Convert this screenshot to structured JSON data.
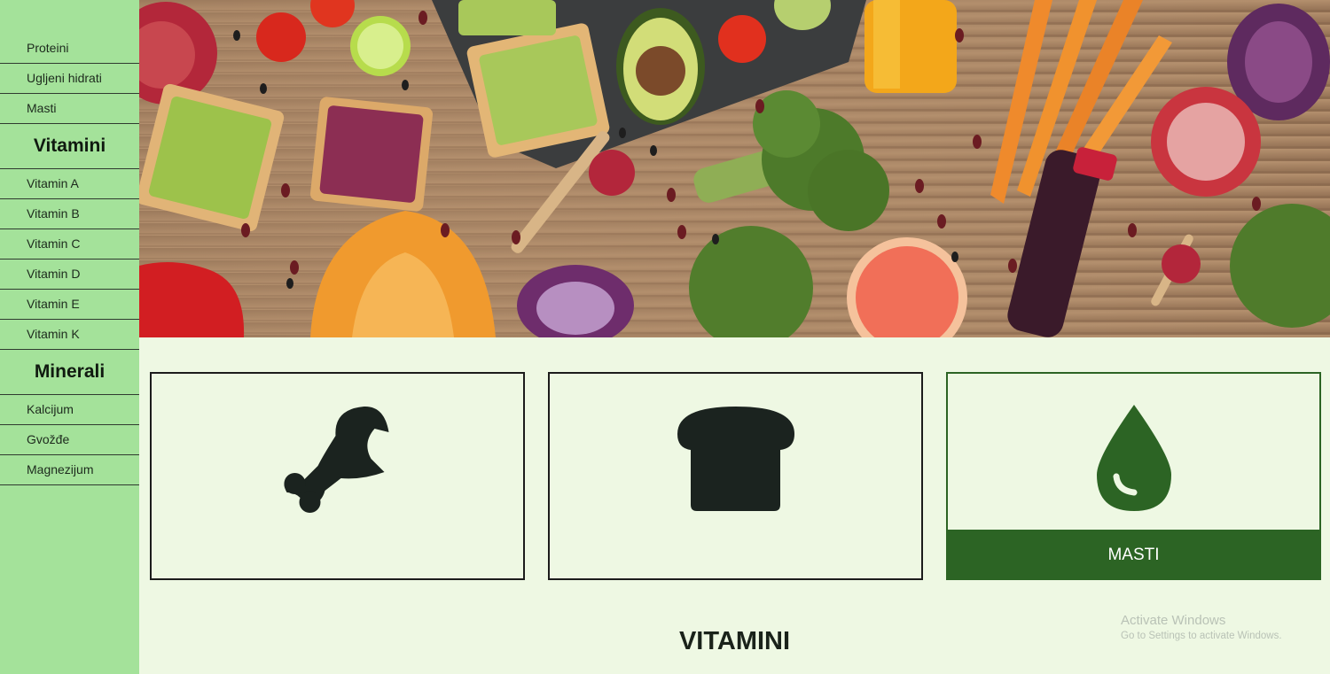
{
  "sidebar": {
    "groups": [
      {
        "heading": "",
        "items": [
          "Proteini",
          "Ugljeni hidrati",
          "Masti"
        ]
      },
      {
        "heading": "Vitamini",
        "items": [
          "Vitamin A",
          "Vitamin B",
          "Vitamin C",
          "Vitamin D",
          "Vitamin E",
          "Vitamin K"
        ]
      },
      {
        "heading": "Minerali",
        "items": [
          "Kalcijum",
          "Gvožđe",
          "Magnezijum"
        ]
      }
    ]
  },
  "cards": [
    {
      "icon": "drumstick-icon",
      "label": ""
    },
    {
      "icon": "bread-icon",
      "label": ""
    },
    {
      "icon": "oil-drop-icon",
      "label": "MASTI"
    }
  ],
  "section_title": "VITAMINI",
  "watermark": {
    "line1": "Activate Windows",
    "line2": "Go to Settings to activate Windows."
  },
  "colors": {
    "sidebar_bg": "#a4e29a",
    "page_bg": "#eef8e3",
    "accent_green": "#2c6424",
    "icon_dark": "#1b231f"
  }
}
